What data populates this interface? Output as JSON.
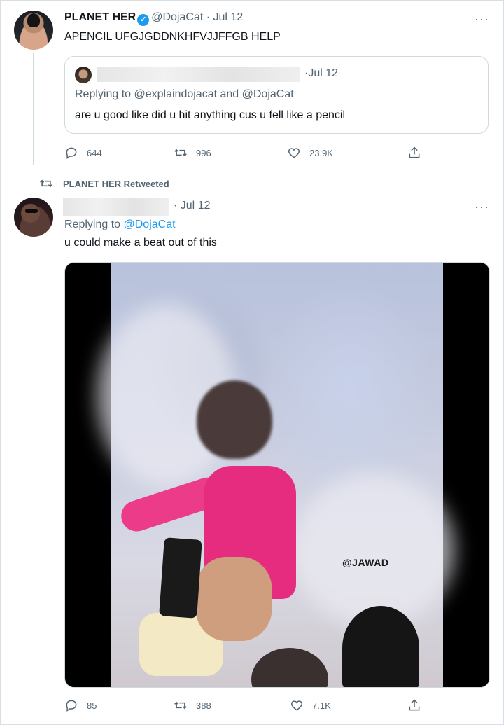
{
  "tweets": [
    {
      "display_name": "PLANET HER",
      "handle": "@DojaCat",
      "separator": "·",
      "date": "Jul 12",
      "text": "APENCIL UFGJGDDNKHFVJJFFGB HELP",
      "quoted": {
        "separator": "·",
        "date": "Jul 12",
        "replying_to": "Replying to @explaindojacat and @DojaCat",
        "text": "are u good like did u hit anything cus u fell like a pencil"
      },
      "stats": {
        "replies": "644",
        "retweets": "996",
        "likes": "23.9K"
      }
    },
    {
      "retweeted_by": "PLANET HER Retweeted",
      "separator": "·",
      "date": "Jul 12",
      "replying_prefix": "Replying to ",
      "replying_handle": "@DojaCat",
      "text": "u could make a beat out of this",
      "media_watermark": "@JAWAD",
      "stats": {
        "replies": "85",
        "retweets": "388",
        "likes": "7.1K"
      }
    }
  ],
  "more_glyph": "···",
  "icons": [
    "verified-badge-icon",
    "more-icon",
    "reply-icon",
    "retweet-icon",
    "like-icon",
    "share-icon"
  ],
  "colors": {
    "accent": "#1d9bf0",
    "muted": "#536471",
    "text": "#0f1419"
  }
}
